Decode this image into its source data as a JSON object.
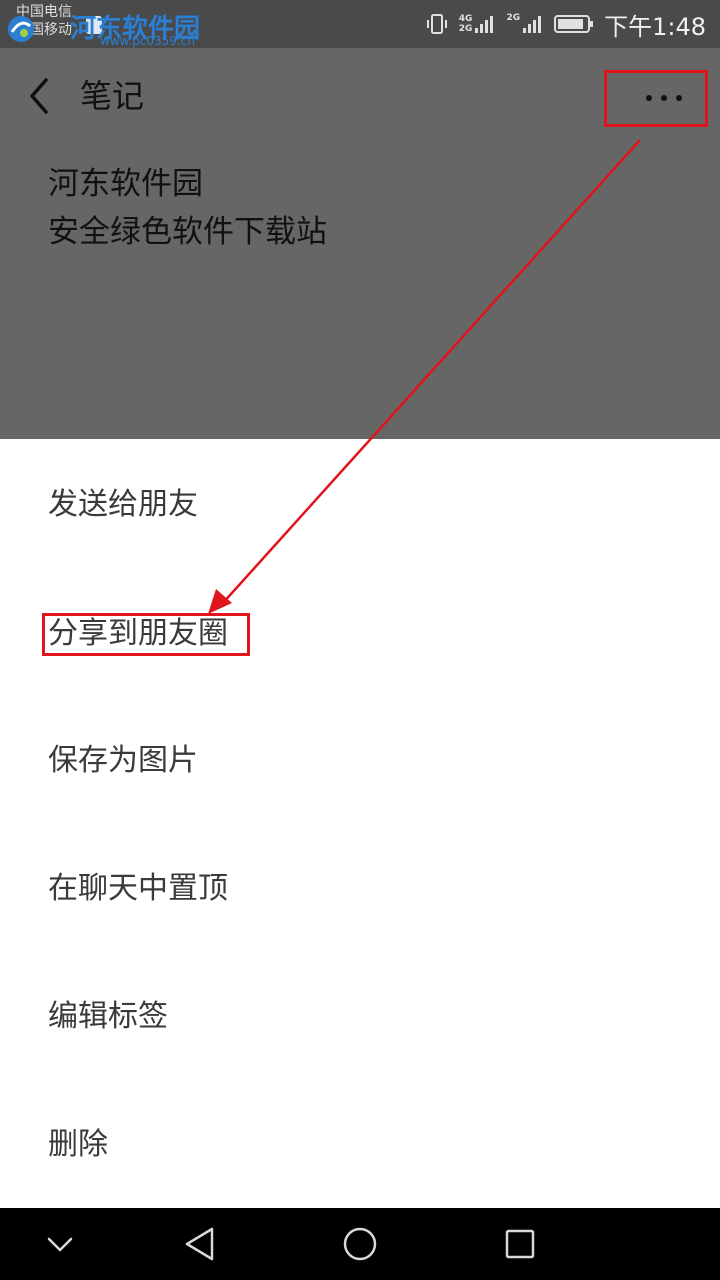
{
  "status_bar": {
    "carrier_1": "中国电信",
    "carrier_2": "中国移动",
    "network_1": "4G",
    "network_2": "2G",
    "network_3": "2G",
    "time": "下午1:48",
    "icons": [
      "vibrate-icon",
      "signal-icon",
      "signal-icon",
      "battery-icon"
    ]
  },
  "watermark": {
    "text": "河东软件园",
    "url": "www.pc0359.cn"
  },
  "header": {
    "title": "笔记",
    "back_icon": "chevron-left-icon",
    "more_icon": "more-dots-icon"
  },
  "note": {
    "lines": [
      "河东软件园",
      "安全绿色软件下载站"
    ]
  },
  "menu": {
    "items": [
      {
        "label": "发送给朋友"
      },
      {
        "label": "分享到朋友圈"
      },
      {
        "label": "保存为图片"
      },
      {
        "label": "在聊天中置顶"
      },
      {
        "label": "编辑标签"
      },
      {
        "label": "删除"
      }
    ]
  },
  "annotation": {
    "highlight_color": "#e0151b",
    "arrow_color": "#e0151b"
  },
  "nav_bar": {
    "icons": [
      "chevron-down-icon",
      "back-triangle-icon",
      "home-circle-icon",
      "recent-square-icon"
    ]
  }
}
